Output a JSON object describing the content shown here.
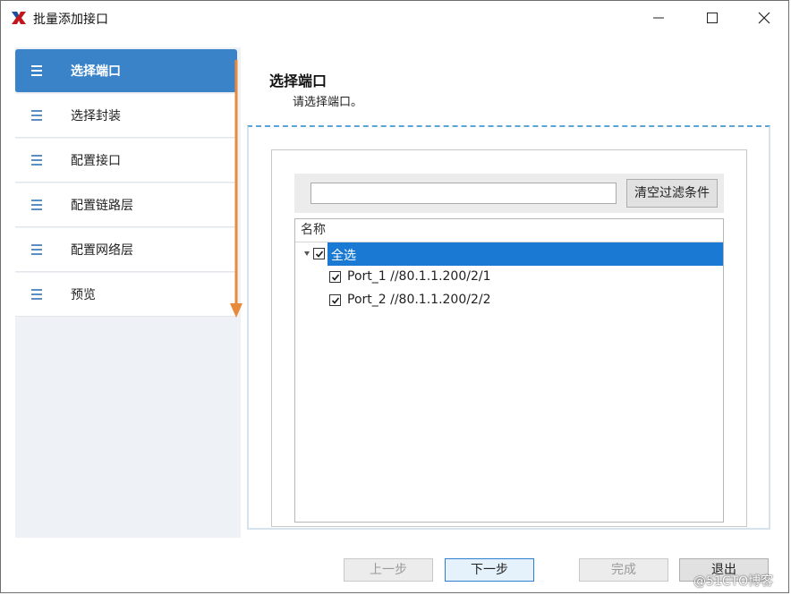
{
  "window": {
    "title": "批量添加接口"
  },
  "sidebar": {
    "items": [
      {
        "label": "选择端口",
        "active": true
      },
      {
        "label": "选择封装",
        "active": false
      },
      {
        "label": "配置接口",
        "active": false
      },
      {
        "label": "配置链路层",
        "active": false
      },
      {
        "label": "配置网络层",
        "active": false
      },
      {
        "label": "预览",
        "active": false
      }
    ]
  },
  "main": {
    "title": "选择端口",
    "subtitle": "请选择端口。"
  },
  "filter": {
    "input_value": "",
    "clear_button": "清空过滤条件"
  },
  "tree": {
    "column_header": "名称",
    "rows": [
      {
        "label": "全选",
        "checked": true,
        "selected": true
      },
      {
        "label": "Port_1 //80.1.1.200/2/1",
        "checked": true,
        "selected": false
      },
      {
        "label": "Port_2 //80.1.1.200/2/2",
        "checked": true,
        "selected": false
      }
    ]
  },
  "footer": {
    "prev": "上一步",
    "next": "下一步",
    "finish": "完成",
    "exit": "退出"
  },
  "watermark": "@51CTO博客",
  "colors": {
    "accent": "#3a83c9",
    "selection": "#1979d3",
    "annotation_arrow": "#e88a3c"
  }
}
